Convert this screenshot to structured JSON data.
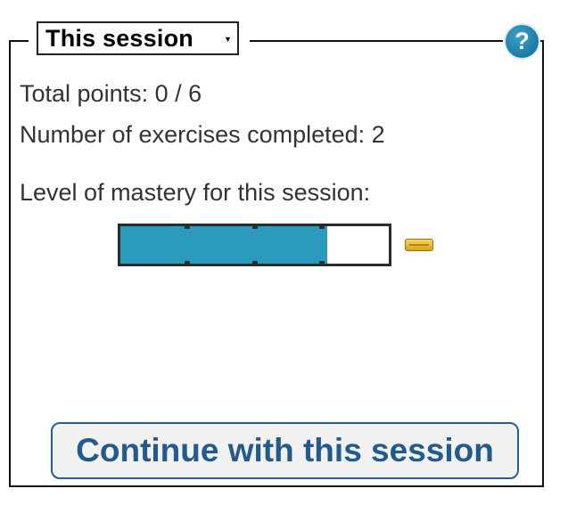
{
  "session_selector": {
    "selected": "This session",
    "arrow_icon": "dropdown-arrow-icon"
  },
  "help": {
    "icon": "help-icon",
    "glyph": "?"
  },
  "stats": {
    "points_text": "Total points: 0 / 6",
    "exercises_text": "Number of exercises completed: 2",
    "mastery_label": "Level of mastery for this session:"
  },
  "mastery": {
    "fraction": 0.77,
    "segments": 4,
    "fill_color": "#2a9bbd",
    "badge_icon": "mastery-badge-icon"
  },
  "actions": {
    "continue_label": "Continue with this session"
  }
}
